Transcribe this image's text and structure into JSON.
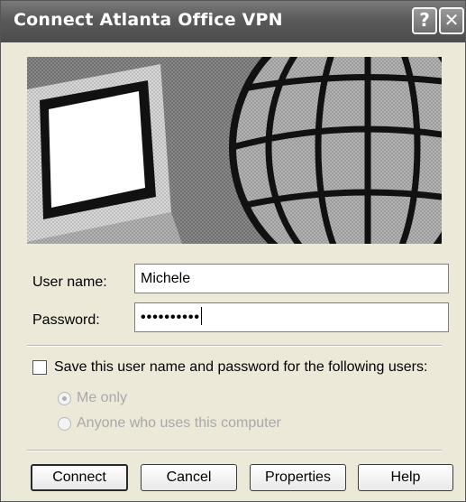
{
  "window": {
    "title": "Connect Atlanta Office VPN",
    "help_glyph": "?",
    "close_glyph": "✕"
  },
  "form": {
    "username_label": "User name:",
    "username_value": "Michele",
    "password_label": "Password:",
    "password_value": "••••••••••"
  },
  "save": {
    "checkbox_label": "Save this user name and password for the following users:",
    "checked": false,
    "options": [
      {
        "label": "Me only",
        "selected": true,
        "enabled": false
      },
      {
        "label": "Anyone who uses this computer",
        "selected": false,
        "enabled": false
      }
    ]
  },
  "buttons": {
    "connect": "Connect",
    "cancel": "Cancel",
    "properties": "Properties",
    "help": "Help"
  },
  "icons": {
    "banner": "computer-globe-network-icon",
    "help": "help-icon",
    "close": "close-icon"
  }
}
